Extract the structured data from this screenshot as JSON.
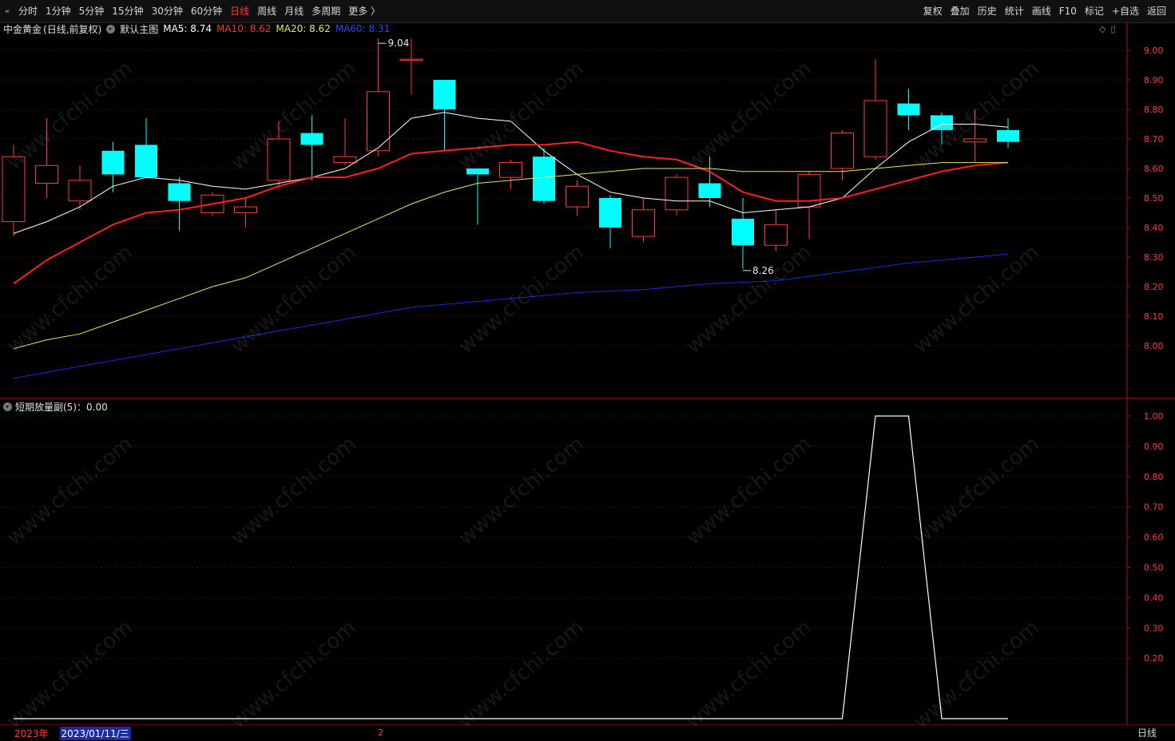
{
  "toolbar": {
    "collapse_icon": "double-chevron-left-icon",
    "periods": [
      "分时",
      "1分钟",
      "5分钟",
      "15分钟",
      "30分钟",
      "60分钟",
      "日线",
      "周线",
      "月线",
      "多周期",
      "更多 〉"
    ],
    "active_period": "日线",
    "right_buttons": [
      "复权",
      "叠加",
      "历史",
      "统计",
      "画线",
      "F10",
      "标记",
      "+自选",
      "返回"
    ]
  },
  "main_legend": {
    "title": "中金黄金",
    "mode": "(日线,前复权)",
    "indicator": "默认主图",
    "ma5": "MA5: 8.74",
    "ma10": "MA10: 8.62",
    "ma20": "MA20: 8.62",
    "ma60": "MA60: 8.31"
  },
  "sub_legend": {
    "name": "短期放量副(5)：0.00"
  },
  "bottom": {
    "year": "2023年",
    "date": "2023/01/11/三",
    "month_mark": "2",
    "period": "日线"
  },
  "watermark": "www.cfchi.com",
  "colors": {
    "up": "#ff3b3b",
    "down": "#00ffff",
    "ma5": "#ffffff",
    "ma10": "#ff2020",
    "ma20": "#e8e860",
    "ma60": "#1a2ae0",
    "axis": "#b01010",
    "grid": "#5a0000"
  },
  "chart_data": [
    {
      "type": "candlestick",
      "title": "中金黄金 (日线,前复权)",
      "ylim": [
        7.89,
        9.05
      ],
      "yticks": [
        "9.00",
        "8.90",
        "8.80",
        "8.70",
        "8.60",
        "8.50",
        "8.40",
        "8.30",
        "8.20",
        "8.10",
        "8.00"
      ],
      "candles": [
        {
          "o": 8.42,
          "h": 8.68,
          "l": 8.37,
          "c": 8.64
        },
        {
          "o": 8.55,
          "h": 8.77,
          "l": 8.5,
          "c": 8.61
        },
        {
          "o": 8.49,
          "h": 8.61,
          "l": 8.46,
          "c": 8.56
        },
        {
          "o": 8.66,
          "h": 8.69,
          "l": 8.52,
          "c": 8.58
        },
        {
          "o": 8.68,
          "h": 8.77,
          "l": 8.57,
          "c": 8.57
        },
        {
          "o": 8.55,
          "h": 8.57,
          "l": 8.39,
          "c": 8.49
        },
        {
          "o": 8.45,
          "h": 8.52,
          "l": 8.44,
          "c": 8.51
        },
        {
          "o": 8.45,
          "h": 8.5,
          "l": 8.4,
          "c": 8.47
        },
        {
          "o": 8.56,
          "h": 8.76,
          "l": 8.53,
          "c": 8.7
        },
        {
          "o": 8.72,
          "h": 8.78,
          "l": 8.56,
          "c": 8.68
        },
        {
          "o": 8.62,
          "h": 8.77,
          "l": 8.61,
          "c": 8.64
        },
        {
          "o": 8.66,
          "h": 9.04,
          "l": 8.64,
          "c": 8.86
        },
        {
          "o": 8.97,
          "h": 9.04,
          "l": 8.85,
          "c": 8.97
        },
        {
          "o": 8.9,
          "h": 8.9,
          "l": 8.66,
          "c": 8.8
        },
        {
          "o": 8.6,
          "h": 8.6,
          "l": 8.41,
          "c": 8.58
        },
        {
          "o": 8.57,
          "h": 8.63,
          "l": 8.53,
          "c": 8.62
        },
        {
          "o": 8.64,
          "h": 8.67,
          "l": 8.48,
          "c": 8.49
        },
        {
          "o": 8.47,
          "h": 8.56,
          "l": 8.44,
          "c": 8.54
        },
        {
          "o": 8.5,
          "h": 8.51,
          "l": 8.33,
          "c": 8.4
        },
        {
          "o": 8.37,
          "h": 8.5,
          "l": 8.35,
          "c": 8.46
        },
        {
          "o": 8.46,
          "h": 8.58,
          "l": 8.44,
          "c": 8.57
        },
        {
          "o": 8.55,
          "h": 8.64,
          "l": 8.47,
          "c": 8.5
        },
        {
          "o": 8.43,
          "h": 8.5,
          "l": 8.26,
          "c": 8.34
        },
        {
          "o": 8.34,
          "h": 8.46,
          "l": 8.32,
          "c": 8.41
        },
        {
          "o": 8.47,
          "h": 8.59,
          "l": 8.36,
          "c": 8.58
        },
        {
          "o": 8.6,
          "h": 8.73,
          "l": 8.56,
          "c": 8.72
        },
        {
          "o": 8.64,
          "h": 8.97,
          "l": 8.63,
          "c": 8.83
        },
        {
          "o": 8.82,
          "h": 8.87,
          "l": 8.73,
          "c": 8.78
        },
        {
          "o": 8.78,
          "h": 8.79,
          "l": 8.68,
          "c": 8.73
        },
        {
          "o": 8.69,
          "h": 8.8,
          "l": 8.62,
          "c": 8.7
        },
        {
          "o": 8.73,
          "h": 8.77,
          "l": 8.67,
          "c": 8.69
        }
      ],
      "series": [
        {
          "name": "MA5",
          "values": [
            8.38,
            8.42,
            8.47,
            8.54,
            8.57,
            8.56,
            8.54,
            8.53,
            8.55,
            8.57,
            8.6,
            8.67,
            8.77,
            8.79,
            8.77,
            8.76,
            8.66,
            8.58,
            8.52,
            8.5,
            8.49,
            8.49,
            8.45,
            8.46,
            8.47,
            8.5,
            8.6,
            8.69,
            8.75,
            8.75,
            8.74
          ]
        },
        {
          "name": "MA10",
          "values": [
            8.21,
            8.29,
            8.35,
            8.41,
            8.45,
            8.46,
            8.48,
            8.5,
            8.54,
            8.57,
            8.57,
            8.6,
            8.65,
            8.66,
            8.67,
            8.68,
            8.68,
            8.69,
            8.66,
            8.64,
            8.63,
            8.59,
            8.52,
            8.49,
            8.49,
            8.5,
            8.53,
            8.56,
            8.59,
            8.61,
            8.62
          ]
        },
        {
          "name": "MA20",
          "values": [
            7.99,
            8.02,
            8.04,
            8.08,
            8.12,
            8.16,
            8.2,
            8.23,
            8.28,
            8.33,
            8.38,
            8.43,
            8.48,
            8.52,
            8.55,
            8.56,
            8.57,
            8.58,
            8.59,
            8.6,
            8.6,
            8.6,
            8.59,
            8.59,
            8.59,
            8.59,
            8.6,
            8.61,
            8.62,
            8.62,
            8.62
          ]
        },
        {
          "name": "MA60",
          "values": [
            7.89,
            7.91,
            7.93,
            7.95,
            7.97,
            7.99,
            8.01,
            8.03,
            8.05,
            8.07,
            8.09,
            8.11,
            8.13,
            8.14,
            8.15,
            8.16,
            8.17,
            8.18,
            8.185,
            8.19,
            8.2,
            8.21,
            8.215,
            8.22,
            8.235,
            8.25,
            8.265,
            8.28,
            8.29,
            8.3,
            8.31
          ]
        }
      ],
      "annotations": [
        {
          "text": "9.04",
          "at_index": 11,
          "value": 9.04
        },
        {
          "text": "8.26",
          "at_index": 22,
          "value": 8.26
        }
      ]
    },
    {
      "type": "line",
      "title": "短期放量副(5)",
      "ylim": [
        0,
        1.05
      ],
      "yticks": [
        "1.00",
        "0.90",
        "0.80",
        "0.70",
        "0.60",
        "0.50",
        "0.40",
        "0.30",
        "0.20"
      ],
      "series": [
        {
          "name": "短期放量副",
          "values": [
            0,
            0,
            0,
            0,
            0,
            0,
            0,
            0,
            0,
            0,
            0,
            0,
            0,
            0,
            0,
            0,
            0,
            0,
            0,
            0,
            0,
            0,
            0,
            0,
            0,
            0,
            1,
            1,
            0,
            0,
            0
          ]
        }
      ]
    }
  ]
}
